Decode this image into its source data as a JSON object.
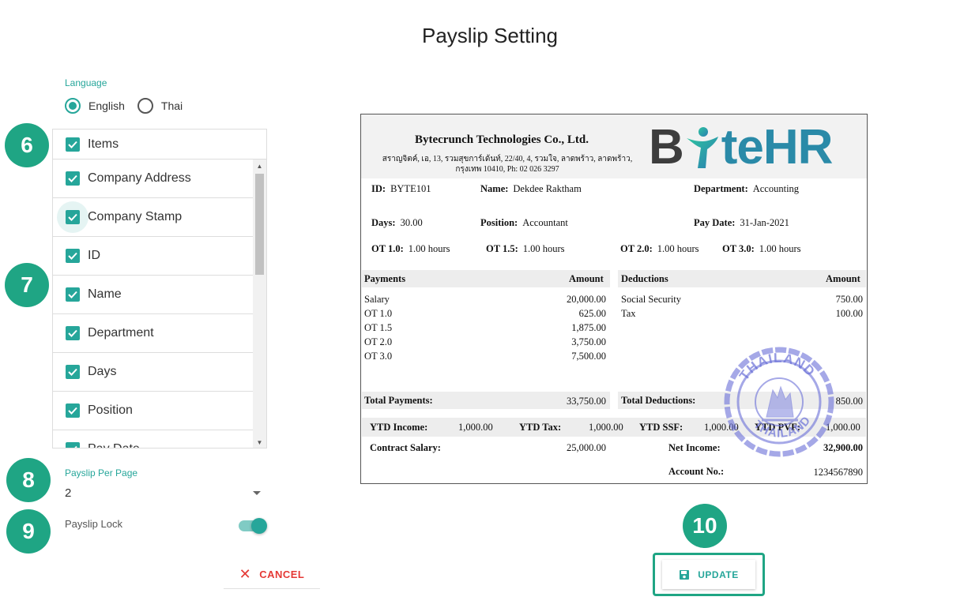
{
  "page": {
    "title": "Payslip Setting"
  },
  "language": {
    "label": "Language",
    "options": [
      "English",
      "Thai"
    ],
    "selected": "English"
  },
  "badges": [
    "6",
    "7",
    "8",
    "9",
    "10"
  ],
  "items": {
    "header": "Items",
    "list": [
      "Company Address",
      "Company Stamp",
      "ID",
      "Name",
      "Department",
      "Days",
      "Position",
      "Pay Date"
    ]
  },
  "payslip_per_page": {
    "label": "Payslip Per Page",
    "value": "2"
  },
  "payslip_lock": {
    "label": "Payslip Lock",
    "on": true
  },
  "buttons": {
    "cancel": "CANCEL",
    "update": "UPDATE"
  },
  "colors": {
    "accent": "#26a69a",
    "badge": "#1fa584",
    "cancel": "#e53935"
  },
  "payslip": {
    "company_name": "Bytecrunch Technologies Co., Ltd.",
    "company_address": "สราญจิตค์, เอ, 13, รวมสุขการ์เด้นท์, 22/40, 4, รวมใจ, ลาดพร้าว, ลาดพร้าว, กรุงเทพ 10410, Ph: 02 026 3297",
    "logo": {
      "left": "B",
      "right": "teHR"
    },
    "fields": {
      "id_label": "ID:",
      "id": "BYTE101",
      "name_label": "Name:",
      "name": "Dekdee Raktham",
      "dept_label": "Department:",
      "dept": "Accounting",
      "days_label": "Days:",
      "days": "30.00",
      "position_label": "Position:",
      "position": "Accountant",
      "paydate_label": "Pay Date:",
      "paydate": "31-Jan-2021",
      "ot10_label": "OT 1.0:",
      "ot10": "1.00 hours",
      "ot15_label": "OT 1.5:",
      "ot15": "1.00 hours",
      "ot20_label": "OT 2.0:",
      "ot20": "1.00 hours",
      "ot30_label": "OT 3.0:",
      "ot30": "1.00 hours"
    },
    "payments": {
      "header": "Payments",
      "amount_header": "Amount",
      "rows": [
        {
          "label": "Salary",
          "amount": "20,000.00"
        },
        {
          "label": "OT 1.0",
          "amount": "625.00"
        },
        {
          "label": "OT 1.5",
          "amount": "1,875.00"
        },
        {
          "label": "OT 2.0",
          "amount": "3,750.00"
        },
        {
          "label": "OT 3.0",
          "amount": "7,500.00"
        }
      ],
      "total_label": "Total Payments:",
      "total": "33,750.00"
    },
    "deductions": {
      "header": "Deductions",
      "amount_header": "Amount",
      "rows": [
        {
          "label": "Social Security",
          "amount": "750.00"
        },
        {
          "label": "Tax",
          "amount": "100.00"
        }
      ],
      "total_label": "Total Deductions:",
      "total": "850.00"
    },
    "ytd": {
      "income_label": "YTD Income:",
      "income": "1,000.00",
      "tax_label": "YTD Tax:",
      "tax": "1,000.00",
      "ssf_label": "YTD SSF:",
      "ssf": "1,000.00",
      "pvf_label": "YTD PVF:",
      "pvf": "1,000.00"
    },
    "contract_salary_label": "Contract Salary:",
    "contract_salary": "25,000.00",
    "net_income_label": "Net Income:",
    "net_income": "32,900.00",
    "account_label": "Account No.:",
    "account": "1234567890",
    "stamp_text": [
      "THAILAND",
      "THAILAND"
    ]
  }
}
